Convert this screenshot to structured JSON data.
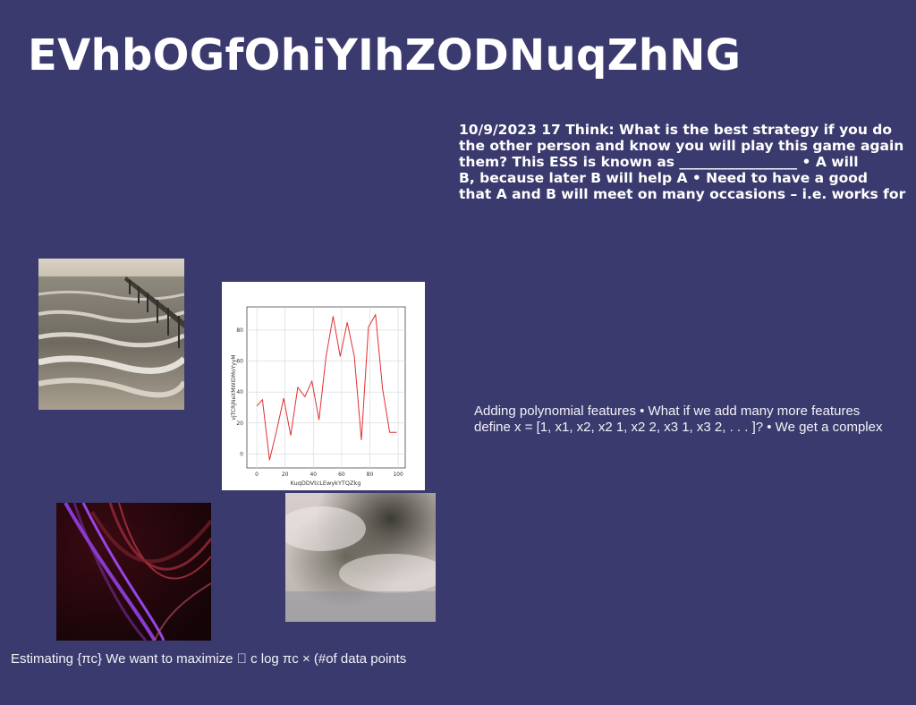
{
  "slide": {
    "title": "EVhbOGfOhiYIhZODNuqZhNG",
    "text_a_lines": [
      "10/9/2023 17 Think: What is the best strategy if you do",
      "the other person and know you will play this game again",
      "them? This ESS is known as _________________ • A will",
      "B, because later B will help A • Need to have a good",
      "that A and B will meet on many occasions – i.e. works for"
    ],
    "text_b_lines": [
      "Adding polynomial features • What if we add many more features",
      "define x = [1, x1, x2, x2 1, x2 2, x3 1, x3 2, . . . ]? • We get a complex"
    ],
    "caption": "Estimating {πc} We want to maximize ￿ c log πc × (#of data points"
  },
  "images": {
    "pier": "photo-pier-sea",
    "swirl": "abstract-light-swirl",
    "fog": "foggy-landscape"
  },
  "chart_data": {
    "type": "line",
    "title": "",
    "xlabel": "KuqDDVtcLEwykYTQZkg",
    "ylabel": "vjTCRjNeXMWIDMoYyyM",
    "xlim": [
      -7,
      105
    ],
    "ylim": [
      -9,
      95
    ],
    "xticks": [
      0,
      20,
      40,
      60,
      80,
      100
    ],
    "yticks": [
      0,
      20,
      40,
      60,
      80
    ],
    "grid": true,
    "color": "#e03030",
    "x": [
      0,
      4,
      9,
      14,
      19,
      24,
      29,
      34,
      39,
      44,
      49,
      54,
      59,
      64,
      69,
      74,
      79,
      84,
      89,
      94,
      99
    ],
    "y": [
      31,
      35,
      -4,
      15,
      36,
      12,
      43,
      37,
      47,
      22,
      63,
      89,
      63,
      85,
      63,
      9,
      82,
      90,
      42,
      14,
      14
    ]
  }
}
